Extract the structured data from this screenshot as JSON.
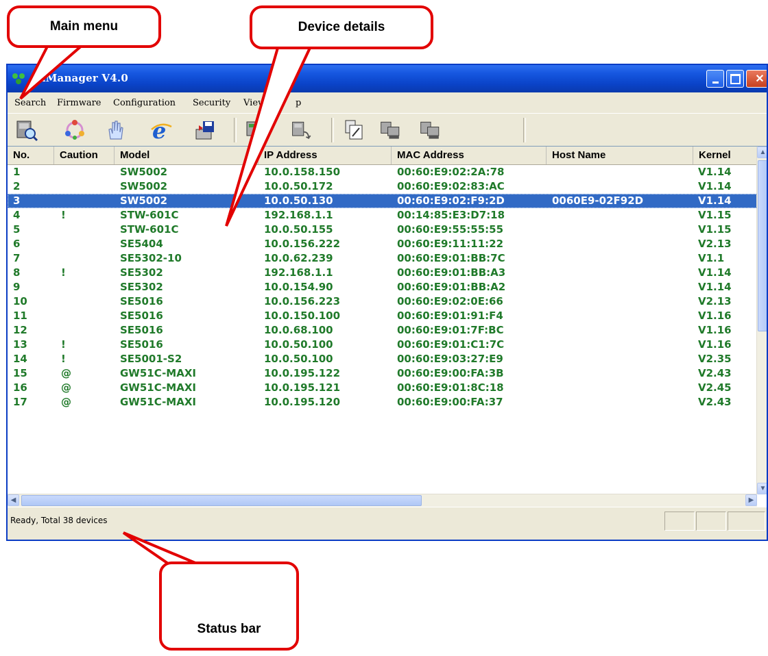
{
  "window": {
    "title": "SerialManager V4.0",
    "title_visible": "ialManager V4.0"
  },
  "menu": {
    "items": [
      "Search",
      "Firmware",
      "Configuration",
      "Security",
      "View",
      "p"
    ]
  },
  "toolbar": {
    "buttons": [
      "search-devices-icon",
      "network-icon",
      "hand-icon",
      "internet-explorer-icon",
      "save-disk-icon",
      "device-upgrade-icon",
      "device-export-icon",
      "edit-config-icon",
      "device-network-icon",
      "device-network-2-icon"
    ]
  },
  "table": {
    "columns": [
      "No.",
      "Caution",
      "Model",
      "IP Address",
      "MAC Address",
      "Host Name",
      "Kernel"
    ],
    "rows": [
      {
        "no": "1",
        "caution": "",
        "model": "SW5002",
        "ip": "10.0.158.150",
        "mac": "00:60:E9:02:2A:78",
        "host": "",
        "kernel": "V1.14"
      },
      {
        "no": "2",
        "caution": "",
        "model": "SW5002",
        "ip": "10.0.50.172",
        "mac": "00:60:E9:02:83:AC",
        "host": "",
        "kernel": "V1.14"
      },
      {
        "no": "3",
        "caution": "",
        "model": "SW5002",
        "ip": "10.0.50.130",
        "mac": "00:60:E9:02:F9:2D",
        "host": "0060E9-02F92D",
        "kernel": "V1.14"
      },
      {
        "no": "4",
        "caution": "!",
        "model": "STW-601C",
        "ip": "192.168.1.1",
        "mac": "00:14:85:E3:D7:18",
        "host": "",
        "kernel": "V1.15"
      },
      {
        "no": "5",
        "caution": "",
        "model": "STW-601C",
        "ip": "10.0.50.155",
        "mac": "00:60:E9:55:55:55",
        "host": "",
        "kernel": "V1.15"
      },
      {
        "no": "6",
        "caution": "",
        "model": "SE5404",
        "ip": "10.0.156.222",
        "mac": "00:60:E9:11:11:22",
        "host": "",
        "kernel": "V2.13"
      },
      {
        "no": "7",
        "caution": "",
        "model": "SE5302-10",
        "ip": "10.0.62.239",
        "mac": "00:60:E9:01:BB:7C",
        "host": "",
        "kernel": "V1.1"
      },
      {
        "no": "8",
        "caution": "!",
        "model": "SE5302",
        "ip": "192.168.1.1",
        "mac": "00:60:E9:01:BB:A3",
        "host": "",
        "kernel": "V1.14"
      },
      {
        "no": "9",
        "caution": "",
        "model": "SE5302",
        "ip": "10.0.154.90",
        "mac": "00:60:E9:01:BB:A2",
        "host": "",
        "kernel": "V1.14"
      },
      {
        "no": "10",
        "caution": "",
        "model": "SE5016",
        "ip": "10.0.156.223",
        "mac": "00:60:E9:02:0E:66",
        "host": "",
        "kernel": "V2.13"
      },
      {
        "no": "11",
        "caution": "",
        "model": "SE5016",
        "ip": "10.0.150.100",
        "mac": "00:60:E9:01:91:F4",
        "host": "",
        "kernel": "V1.16"
      },
      {
        "no": "12",
        "caution": "",
        "model": "SE5016",
        "ip": "10.0.68.100",
        "mac": "00:60:E9:01:7F:BC",
        "host": "",
        "kernel": "V1.16"
      },
      {
        "no": "13",
        "caution": "!",
        "model": "SE5016",
        "ip": "10.0.50.100",
        "mac": "00:60:E9:01:C1:7C",
        "host": "",
        "kernel": "V1.16"
      },
      {
        "no": "14",
        "caution": "!",
        "model": "SE5001-S2",
        "ip": "10.0.50.100",
        "mac": "00:60:E9:03:27:E9",
        "host": "",
        "kernel": "V2.35"
      },
      {
        "no": "15",
        "caution": "@",
        "model": "GW51C-MAXI",
        "ip": "10.0.195.122",
        "mac": "00:60:E9:00:FA:3B",
        "host": "",
        "kernel": "V2.43"
      },
      {
        "no": "16",
        "caution": "@",
        "model": "GW51C-MAXI",
        "ip": "10.0.195.121",
        "mac": "00:60:E9:01:8C:18",
        "host": "",
        "kernel": "V2.45"
      },
      {
        "no": "17",
        "caution": "@",
        "model": "GW51C-MAXI",
        "ip": "10.0.195.120",
        "mac": "00:60:E9:00:FA:37",
        "host": "",
        "kernel": "V2.43"
      }
    ],
    "selected_row": "3"
  },
  "status": {
    "text": "Ready, Total 38 devices"
  },
  "callouts": {
    "main_menu": "Main menu",
    "device_details": "Device details",
    "status_bar": "Status bar"
  },
  "colors": {
    "title_blue": "#0a43c8",
    "row_text_green": "#207a2a",
    "selection_blue": "#316ac5",
    "callout_red": "#e20000"
  }
}
